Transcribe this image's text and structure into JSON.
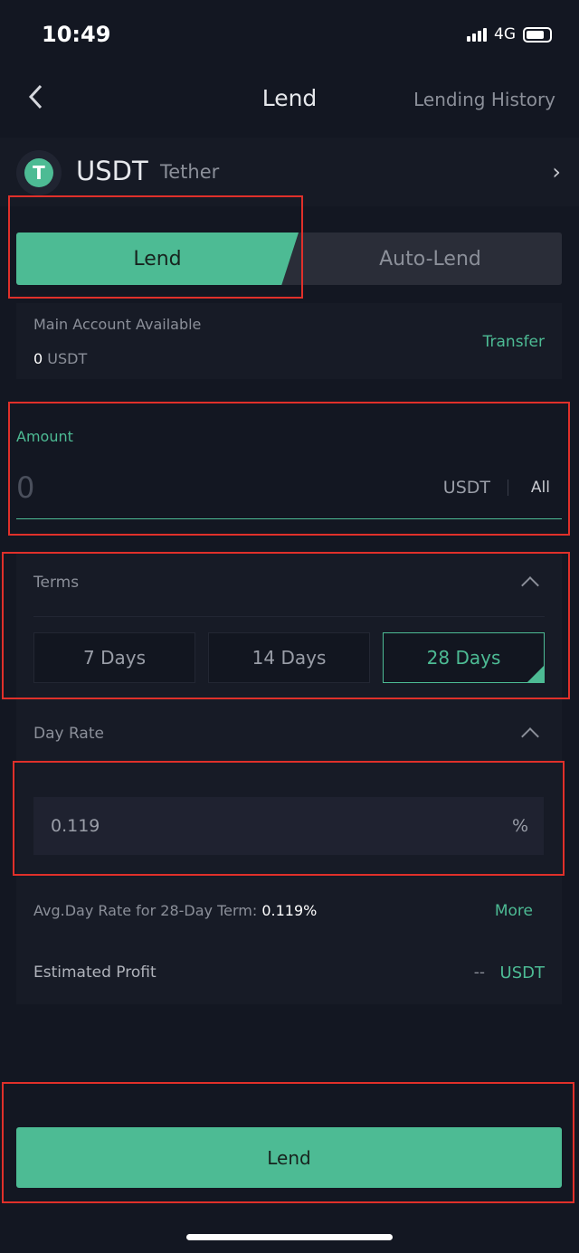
{
  "status_bar": {
    "time": "10:49",
    "network": "4G"
  },
  "header": {
    "title": "Lend",
    "history_link": "Lending History"
  },
  "coin": {
    "symbol": "USDT",
    "name": "Tether",
    "logo_letter": "T"
  },
  "mode_tabs": [
    {
      "label": "Lend",
      "selected": true
    },
    {
      "label": "Auto-Lend",
      "selected": false
    }
  ],
  "account": {
    "label": "Main Account Available",
    "amount": "0",
    "unit": "USDT",
    "transfer_label": "Transfer"
  },
  "amount": {
    "label": "Amount",
    "placeholder": "0",
    "unit": "USDT",
    "all_label": "All"
  },
  "terms": {
    "label": "Terms",
    "options": [
      {
        "label": "7 Days",
        "selected": false
      },
      {
        "label": "14 Days",
        "selected": false
      },
      {
        "label": "28 Days",
        "selected": true
      }
    ]
  },
  "day_rate": {
    "label": "Day Rate",
    "value": "0.119",
    "unit": "%"
  },
  "avg_rate": {
    "label": "Avg.Day Rate for 28-Day Term:",
    "value": "0.119%",
    "more_label": "More"
  },
  "profit": {
    "label": "Estimated Profit",
    "value": "--",
    "unit": "USDT"
  },
  "submit_label": "Lend",
  "colors": {
    "accent": "#4dbb94",
    "background": "#131722",
    "annotation": "#e0302a"
  }
}
